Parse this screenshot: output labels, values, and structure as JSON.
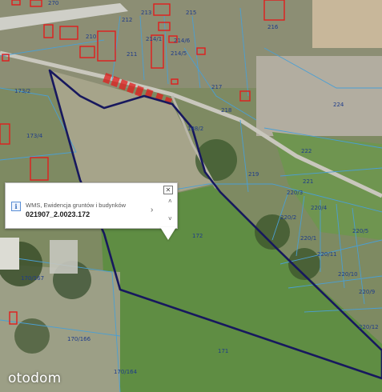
{
  "map": {
    "background_color": "#7e8a62",
    "boundary_color": "#17185e",
    "parcel_line_color": "#4a9fd4",
    "building_color": "#e11d1d",
    "parcel_labels": [
      "270",
      "216",
      "212",
      "213",
      "215",
      "210",
      "211",
      "214/1",
      "214/6",
      "214/5",
      "173/2",
      "217",
      "218",
      "224",
      "173/4",
      "188/2",
      "222",
      "219",
      "221",
      "220/3",
      "220/4",
      "220/2",
      "220/1",
      "220/5",
      "220/11",
      "172",
      "220/10",
      "170/167",
      "220/9",
      "220/12",
      "170/166",
      "171",
      "170/164"
    ]
  },
  "popup": {
    "source": "WMS, Ewidencja gruntów i budynków",
    "parcel_id": "021907_2.0023.172",
    "close_icon": "close-icon",
    "info_icon": "info-icon",
    "next_icon": "chevron-right-icon",
    "up_icon": "chevron-up-icon",
    "down_icon": "chevron-down-icon"
  },
  "brand": {
    "logo_text": "otodom"
  }
}
